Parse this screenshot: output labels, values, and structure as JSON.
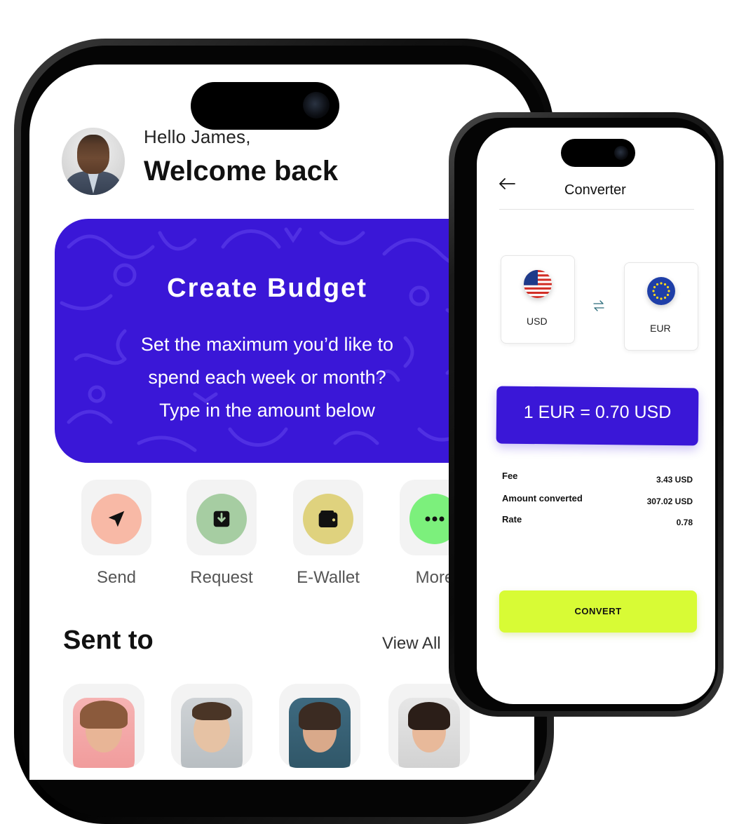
{
  "home": {
    "greeting": "Hello James,",
    "welcome": "Welcome back",
    "budget": {
      "title": "Create Budget",
      "lines": [
        "Set the maximum you’d like to",
        "spend each week or month?",
        "Type in the amount below"
      ]
    },
    "actions": [
      {
        "label": "Send",
        "icon": "send-icon",
        "color": "#f8b9a6"
      },
      {
        "label": "Request",
        "icon": "download-icon",
        "color": "#a6cda2"
      },
      {
        "label": "E-Wallet",
        "icon": "wallet-icon",
        "color": "#dfd27e"
      },
      {
        "label": "More",
        "icon": "more-icon",
        "color": "#7cf07c"
      }
    ],
    "sent_to": {
      "title": "Sent to",
      "view_all": "View All"
    }
  },
  "converter": {
    "title": "Converter",
    "from_currency": "USD",
    "to_currency": "EUR",
    "rate_text": "1 EUR = 0.70 USD",
    "details": [
      {
        "label": "Fee",
        "value": "3.43 USD"
      },
      {
        "label": "Amount converted",
        "value": "307.02 USD"
      },
      {
        "label": "Rate",
        "value": "0.78"
      }
    ],
    "convert_button": "CONVERT",
    "colors": {
      "accent": "#3a17d7",
      "convert": "#d8fb35"
    }
  }
}
